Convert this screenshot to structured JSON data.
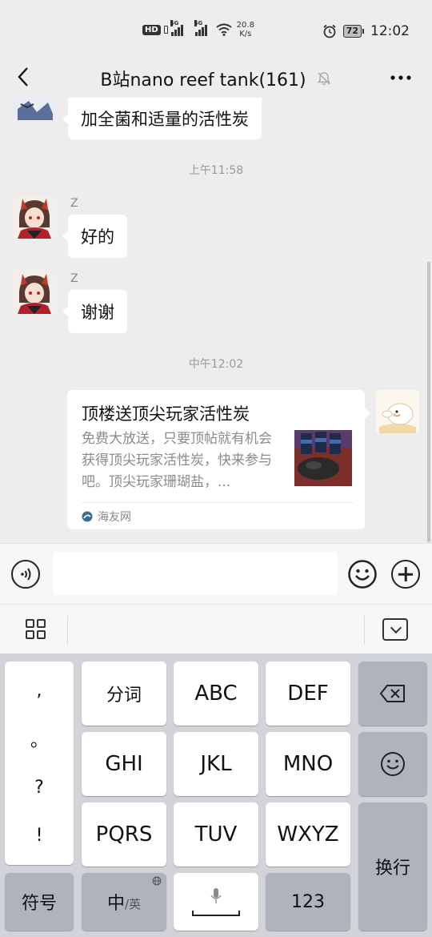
{
  "status_bar": {
    "hd": "HD",
    "net1": "4G",
    "net2": "4G",
    "speed_value": "20.8",
    "speed_unit": "K/s",
    "battery": "72",
    "time": "12:02"
  },
  "header": {
    "title": "B站nano reef tank(161)"
  },
  "messages": {
    "top_partial_text": "加全菌和适量的活性炭",
    "time1": "上午11:58",
    "msg1": {
      "nick": "Z",
      "text": "好的"
    },
    "msg2": {
      "nick": "Z",
      "text": "谢谢"
    },
    "time2": "中午12:02",
    "card": {
      "title": "顶楼送顶尖玩家活性炭",
      "desc": "免费大放送，只要顶帖就有机会获得顶尖玩家活性炭，快来参与吧。顶尖玩家珊瑚盐，...",
      "source": "海友网"
    }
  },
  "input": {
    "placeholder": ""
  },
  "keyboard": {
    "punct": [
      ",",
      "。",
      "?",
      "!"
    ],
    "row1": [
      "分词",
      "ABC",
      "DEF"
    ],
    "row2": [
      "GHI",
      "JKL",
      "MNO"
    ],
    "row3": [
      "PQRS",
      "TUV",
      "WXYZ"
    ],
    "enter": "换行",
    "symbols": "符号",
    "lang_main": "中",
    "lang_sub": "/英",
    "num": "123"
  },
  "colors": {
    "background": "#ededed",
    "keyboard_bg": "#d1d3d9",
    "dark_key": "#aeb3be"
  }
}
